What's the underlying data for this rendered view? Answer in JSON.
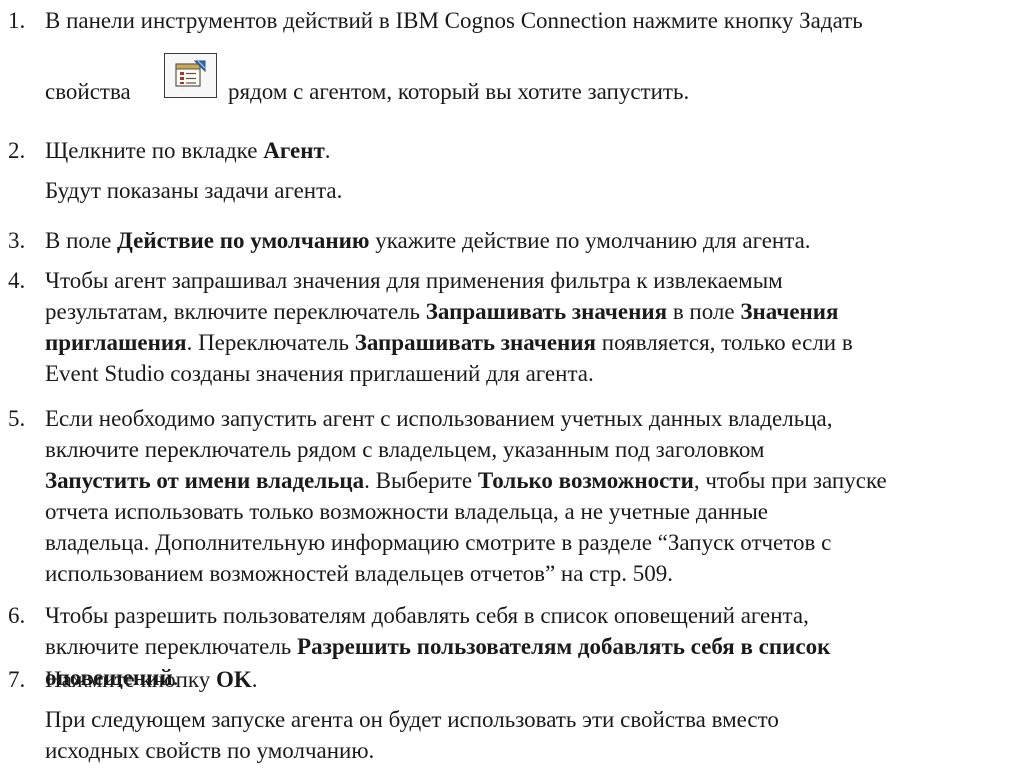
{
  "steps": [
    {
      "num": "1.",
      "line1": "В панели инструментов действий в IBM Cognos Connection нажмите кнопку Задать",
      "before_icon": "свойства",
      "after_icon": "рядом с агентом, который вы хотите запустить.",
      "icon": "set-properties-icon"
    },
    {
      "num": "2.",
      "pre": "Щелкните по вкладке ",
      "bold": "Агент",
      "post": ".",
      "result": "Будут показаны задачи агента."
    },
    {
      "num": "3.",
      "pre": "В поле ",
      "bold": "Действие по умолчанию",
      "post": " укажите действие по умолчанию для агента."
    },
    {
      "num": "4.",
      "l1": "Чтобы агент запрашивал значения для применения фильтра к извлекаемым",
      "l2_pre": "результатам, включите переключатель ",
      "l2_b1": "Запрашивать значения",
      "l2_mid": " в поле ",
      "l2_b2": "Значения",
      "l3_b1": "приглашения",
      "l3_mid": ". Переключатель ",
      "l3_b2": "Запрашивать значения",
      "l3_post": " появляется, только если в",
      "l4": "Event Studio созданы значения приглашений для агента."
    },
    {
      "num": "5.",
      "l1": "Если необходимо запустить агент с использованием учетных данных владельца,",
      "l2": "включите переключатель рядом с владельцем, указанным под заголовком",
      "l3_b1": "Запустить от имени владельца",
      "l3_mid": ". Выберите ",
      "l3_b2": "Только возможности",
      "l3_post": ", чтобы при запуске",
      "l4": "отчета использовать только возможности владельца, а не учетные данные",
      "l5": "владельца. Дополнительную информацию смотрите в разделе “Запуск отчетов с",
      "l6": "использованием возможностей владельцев отчетов” на стр. 509."
    },
    {
      "num": "6.",
      "l1": "Чтобы разрешить пользователям добавлять себя в список оповещений агента,",
      "l2_pre": "включите переключатель ",
      "l2_b": "Разрешить пользователям добавлять себя в список",
      "l3_b": "оповещений",
      "l3_post": "."
    },
    {
      "num": "7.",
      "pre": "Нажмите кнопку ",
      "bold": "OK",
      "post": ".",
      "r1": "При следующем запуске агента он будет использовать эти свойства вместо",
      "r2": "исходных свойств по умолчанию."
    }
  ]
}
